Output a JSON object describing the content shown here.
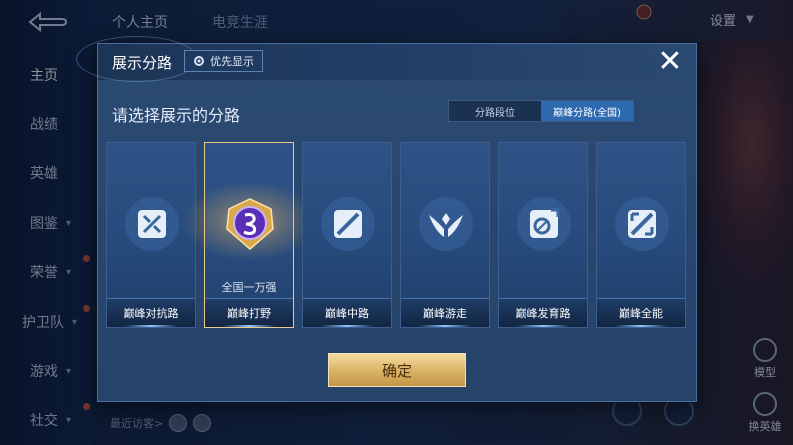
{
  "background": {
    "top_tabs": [
      "个人主页",
      "电竞生涯"
    ],
    "settings_label": "设置",
    "avatar_badge_text": "",
    "sidebar_items": [
      {
        "label": "主页",
        "has_chevron": false
      },
      {
        "label": "战绩",
        "has_chevron": false
      },
      {
        "label": "英雄",
        "has_chevron": false
      },
      {
        "label": "图鉴",
        "has_chevron": true
      },
      {
        "label": "荣誉",
        "has_chevron": true
      },
      {
        "label": "护卫队",
        "has_chevron": true
      },
      {
        "label": "游戏",
        "has_chevron": true
      },
      {
        "label": "社交",
        "has_chevron": true
      }
    ],
    "recent_visitors_label": "最近访客>",
    "right_buttons": {
      "model": "模型",
      "switch_hero": "换英雄"
    }
  },
  "modal": {
    "title": "展示分路",
    "priority_chip": "优先显示",
    "subtitle": "请选择展示的分路",
    "segments": [
      {
        "label": "分路段位",
        "active": false
      },
      {
        "label": "巅峰分路(全国)",
        "active": true
      }
    ],
    "lanes": [
      {
        "label": "巅峰对抗路",
        "icon": "clash-lane-icon",
        "selected": false,
        "rank": ""
      },
      {
        "label": "巅峰打野",
        "icon": "jungle-emblem-icon",
        "selected": true,
        "rank": "全国一万强"
      },
      {
        "label": "巅峰中路",
        "icon": "mid-lane-icon",
        "selected": false,
        "rank": ""
      },
      {
        "label": "巅峰游走",
        "icon": "roam-icon",
        "selected": false,
        "rank": ""
      },
      {
        "label": "巅峰发育路",
        "icon": "farm-lane-icon",
        "selected": false,
        "rank": ""
      },
      {
        "label": "巅峰全能",
        "icon": "all-round-icon",
        "selected": false,
        "rank": ""
      }
    ],
    "confirm_label": "确定",
    "colors": {
      "accent_gold": "#d9b163",
      "segment_active": "#2f6ab0",
      "panel": "#2a4870"
    }
  }
}
